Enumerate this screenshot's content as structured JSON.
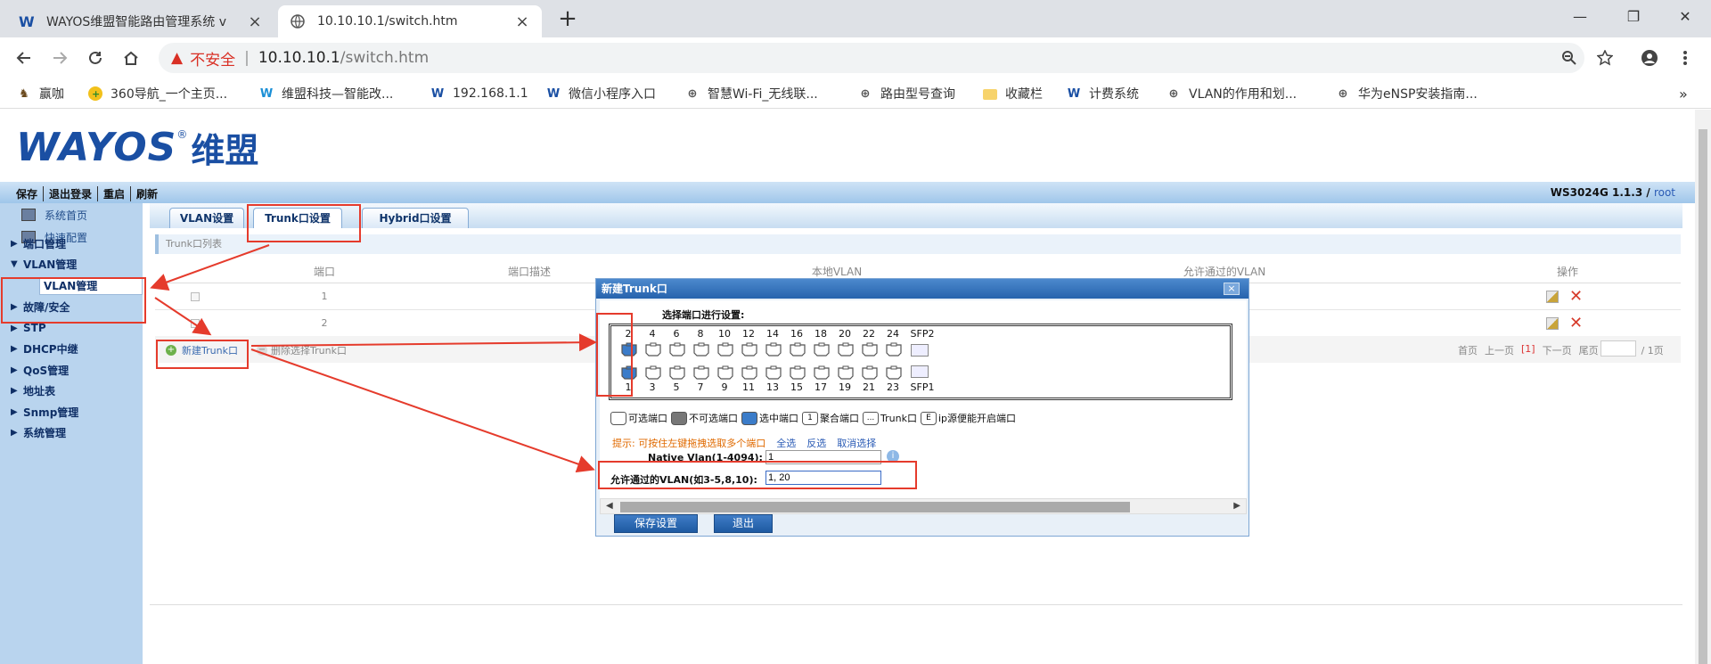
{
  "browser": {
    "tabs": [
      {
        "title": "WAYOS维盟智能路由管理系统 v",
        "active": false
      },
      {
        "title": "10.10.10.1/switch.htm",
        "active": true
      }
    ],
    "address": {
      "warning": "不安全",
      "host": "10.10.10.1",
      "path": "/switch.htm"
    },
    "bookmarks": [
      "赢咖",
      "360导航_一个主页...",
      "维盟科技—智能改...",
      "192.168.1.1",
      "微信小程序入口",
      "智慧Wi-Fi_无线联...",
      "路由型号查询",
      "收藏栏",
      "计费系统",
      "VLAN的作用和划...",
      "华为eNSP安装指南..."
    ],
    "more": "»"
  },
  "app": {
    "logo_en": "WAYOS",
    "logo_reg": "®",
    "logo_cn": "维盟",
    "top_links": [
      "保存",
      "退出登录",
      "重启",
      "刷新"
    ],
    "version": "WS3024G 1.1.3 / ",
    "user": "root"
  },
  "sidebar": {
    "top": [
      "系统首页",
      "快速配置"
    ],
    "items": [
      "端口管理",
      "VLAN管理",
      "故障/安全",
      "STP",
      "DHCP中继",
      "QoS管理",
      "地址表",
      "Snmp管理",
      "系统管理"
    ],
    "sub": "VLAN管理"
  },
  "content": {
    "tabs": [
      "VLAN设置",
      "Trunk口设置",
      "Hybrid口设置"
    ],
    "list_title": "Trunk口列表",
    "columns": [
      "端口",
      "端口描述",
      "本地VLAN",
      "允许通过的VLAN",
      "操作"
    ],
    "rows": [
      {
        "port": "1"
      },
      {
        "port": "2"
      }
    ],
    "new_btn": "新建Trunk口",
    "del_btn": "删除选择Trunk口",
    "pager": {
      "first": "首页",
      "prev": "上一页",
      "cur": "[1]",
      "next": "下一页",
      "last": "尾页",
      "total": "/ 1页"
    }
  },
  "dialog": {
    "title": "新建Trunk口",
    "close": "×",
    "select_title": "选择端口进行设置:",
    "even_ports": [
      "2",
      "4",
      "6",
      "8",
      "10",
      "12",
      "14",
      "16",
      "18",
      "20",
      "22",
      "24"
    ],
    "odd_ports": [
      "1",
      "3",
      "5",
      "7",
      "9",
      "11",
      "13",
      "15",
      "17",
      "19",
      "21",
      "23"
    ],
    "sfp_top": "SFP2",
    "sfp_bottom": "SFP1",
    "legend": [
      "可选端口",
      "不可选端口",
      "选中端口",
      "聚合端口",
      "Trunk口",
      "ip源便能开启端口"
    ],
    "legend_marks": [
      "",
      "",
      "",
      "1",
      "...",
      "E"
    ],
    "hint": "提示: 可按住左键拖拽选取多个端口",
    "select_all": "全选",
    "invert": "反选",
    "cancel_sel": "取消选择",
    "native_vlan_label": "Native Vlan(1-4094):",
    "native_vlan_value": "1",
    "allowed_vlan_label": "允许通过的VLAN(如3-5,8,10):",
    "allowed_vlan_value": "1, 20",
    "save_btn": "保存设置",
    "exit_btn": "退出"
  }
}
